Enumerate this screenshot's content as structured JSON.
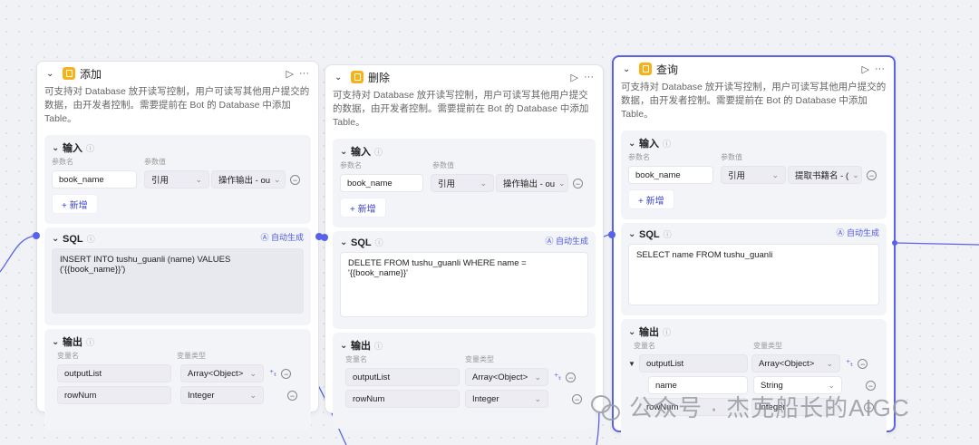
{
  "nodes": [
    {
      "title": "添加",
      "description": "可支持对 Database 放开读写控制，用户可读写其他用户提交的数据，由开发者控制。需要提前在 Bot 的 Database 中添加 Table。",
      "input": {
        "title": "输入",
        "col_name": "参数名",
        "col_value": "参数值",
        "param_name": "book_name",
        "param_type": "引用",
        "param_ref": "操作输出 - ou",
        "add_label": "+ 新增"
      },
      "sql": {
        "title": "SQL",
        "auto_label": "自动生成",
        "code": "INSERT INTO tushu_guanli (name) VALUES ('{{book_name}}')"
      },
      "output": {
        "title": "输出",
        "col_name": "变量名",
        "col_type": "变量类型",
        "rows": [
          {
            "name": "outputList",
            "type": "Array<Object>"
          },
          {
            "name": "rowNum",
            "type": "Integer"
          }
        ]
      }
    },
    {
      "title": "删除",
      "description": "可支持对 Database 放开读写控制，用户可读写其他用户提交的数据，由开发者控制。需要提前在 Bot 的 Database 中添加 Table。",
      "input": {
        "title": "输入",
        "col_name": "参数名",
        "col_value": "参数值",
        "param_name": "book_name",
        "param_type": "引用",
        "param_ref": "操作输出 - ou",
        "add_label": "+ 新增"
      },
      "sql": {
        "title": "SQL",
        "auto_label": "自动生成",
        "code": "DELETE FROM tushu_guanli WHERE name = '{{book_name}}'"
      },
      "output": {
        "title": "输出",
        "col_name": "变量名",
        "col_type": "变量类型",
        "rows": [
          {
            "name": "outputList",
            "type": "Array<Object>"
          },
          {
            "name": "rowNum",
            "type": "Integer"
          }
        ]
      }
    },
    {
      "title": "查询",
      "description": "可支持对 Database 放开读写控制，用户可读写其他用户提交的数据，由开发者控制。需要提前在 Bot 的 Database 中添加 Table。",
      "input": {
        "title": "输入",
        "col_name": "参数名",
        "col_value": "参数值",
        "param_name": "book_name",
        "param_type": "引用",
        "param_ref": "提取书籍名 - (",
        "add_label": "+ 新增"
      },
      "sql": {
        "title": "SQL",
        "auto_label": "自动生成",
        "code": "SELECT name FROM tushu_guanli"
      },
      "output": {
        "title": "输出",
        "col_name": "变量名",
        "col_type": "变量类型",
        "rows": [
          {
            "name": "outputList",
            "type": "Array<Object>"
          },
          {
            "name": "name",
            "type": "String"
          },
          {
            "name": "rowNum",
            "type": "Integer"
          }
        ]
      }
    }
  ],
  "watermark": "公众号 · 杰克船长的AIGC",
  "colors": {
    "accent": "#5a63e8",
    "icon": "#f6b21b",
    "canvas": "#f1f2f6"
  }
}
